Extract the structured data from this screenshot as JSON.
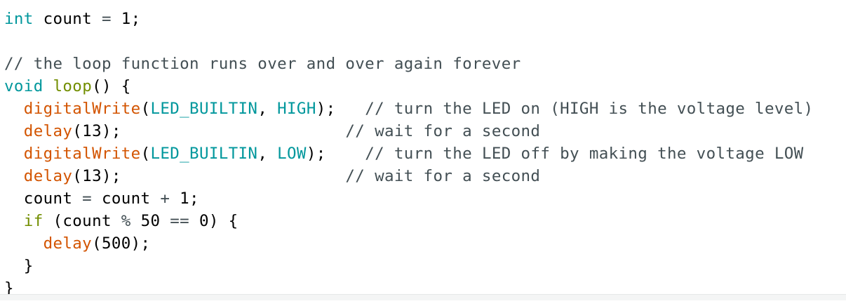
{
  "editor": {
    "lines": [
      [
        {
          "text": "int",
          "type": "kw"
        },
        {
          "text": " count ",
          "type": ""
        },
        {
          "text": "=",
          "type": "op"
        },
        {
          "text": " 1;",
          "type": ""
        }
      ],
      [],
      [
        {
          "text": "// the loop function runs over and over again forever",
          "type": "cm"
        }
      ],
      [
        {
          "text": "void",
          "type": "kw"
        },
        {
          "text": " ",
          "type": ""
        },
        {
          "text": "loop",
          "type": "ctl"
        },
        {
          "text": "() {",
          "type": ""
        }
      ],
      [
        {
          "text": "  ",
          "type": ""
        },
        {
          "text": "digitalWrite",
          "type": "fn"
        },
        {
          "text": "(",
          "type": ""
        },
        {
          "text": "LED_BUILTIN",
          "type": "cnst"
        },
        {
          "text": ", ",
          "type": ""
        },
        {
          "text": "HIGH",
          "type": "cnst"
        },
        {
          "text": ");   ",
          "type": ""
        },
        {
          "text": "// turn the LED on (HIGH is the voltage level)",
          "type": "cm"
        }
      ],
      [
        {
          "text": "  ",
          "type": ""
        },
        {
          "text": "delay",
          "type": "fn"
        },
        {
          "text": "(13);                       ",
          "type": ""
        },
        {
          "text": "// wait for a second",
          "type": "cm"
        }
      ],
      [
        {
          "text": "  ",
          "type": ""
        },
        {
          "text": "digitalWrite",
          "type": "fn"
        },
        {
          "text": "(",
          "type": ""
        },
        {
          "text": "LED_BUILTIN",
          "type": "cnst"
        },
        {
          "text": ", ",
          "type": ""
        },
        {
          "text": "LOW",
          "type": "cnst"
        },
        {
          "text": ");    ",
          "type": ""
        },
        {
          "text": "// turn the LED off by making the voltage LOW",
          "type": "cm"
        }
      ],
      [
        {
          "text": "  ",
          "type": ""
        },
        {
          "text": "delay",
          "type": "fn"
        },
        {
          "text": "(13);                       ",
          "type": ""
        },
        {
          "text": "// wait for a second",
          "type": "cm"
        }
      ],
      [
        {
          "text": "  count ",
          "type": ""
        },
        {
          "text": "=",
          "type": "op"
        },
        {
          "text": " count ",
          "type": ""
        },
        {
          "text": "+",
          "type": "op"
        },
        {
          "text": " 1;",
          "type": ""
        }
      ],
      [
        {
          "text": "  ",
          "type": ""
        },
        {
          "text": "if",
          "type": "ctl"
        },
        {
          "text": " (count ",
          "type": ""
        },
        {
          "text": "%",
          "type": "op"
        },
        {
          "text": " 50 ",
          "type": ""
        },
        {
          "text": "==",
          "type": "op"
        },
        {
          "text": " 0) {",
          "type": ""
        }
      ],
      [
        {
          "text": "    ",
          "type": ""
        },
        {
          "text": "delay",
          "type": "fn"
        },
        {
          "text": "(500);",
          "type": ""
        }
      ],
      [
        {
          "text": "  }",
          "type": ""
        }
      ],
      [
        {
          "text": "}",
          "type": ""
        }
      ]
    ]
  },
  "theme": {
    "keyword": "#00979c",
    "function": "#d35400",
    "constant": "#00979c",
    "control": "#728e00",
    "comment": "#434f54",
    "text": "#000000"
  }
}
